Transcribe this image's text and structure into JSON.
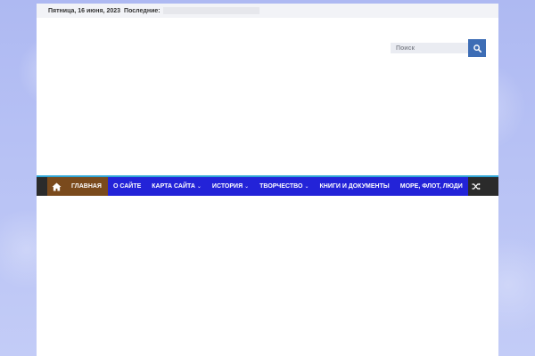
{
  "topbar": {
    "date": "Пятница, 16 июня, 2023",
    "latest_label": "Последние:"
  },
  "search": {
    "placeholder": "Поиск",
    "icon": "search-icon"
  },
  "nav": {
    "home_icon": "home-icon",
    "items": [
      {
        "label": "ГЛАВНАЯ",
        "active": true,
        "dropdown": false
      },
      {
        "label": "О САЙТЕ",
        "active": false,
        "dropdown": false
      },
      {
        "label": "КАРТА САЙТА",
        "active": false,
        "dropdown": true
      },
      {
        "label": "ИСТОРИЯ",
        "active": false,
        "dropdown": true
      },
      {
        "label": "ТВОРЧЕСТВО",
        "active": false,
        "dropdown": true
      },
      {
        "label": "КНИГИ И ДОКУМЕНТЫ",
        "active": false,
        "dropdown": false
      },
      {
        "label": "МОРЕ, ФЛОТ, ЛЮДИ",
        "active": false,
        "dropdown": false
      }
    ],
    "random_icon": "shuffle-icon",
    "chevron": "⌄"
  },
  "colors": {
    "background": "#b9c4f4",
    "nav_bar": "#2b2b2b",
    "nav_menu": "#2323d8",
    "active_item": "#7a4a1c",
    "accent_line": "#30a6d6",
    "search_button": "#3d6db5"
  }
}
